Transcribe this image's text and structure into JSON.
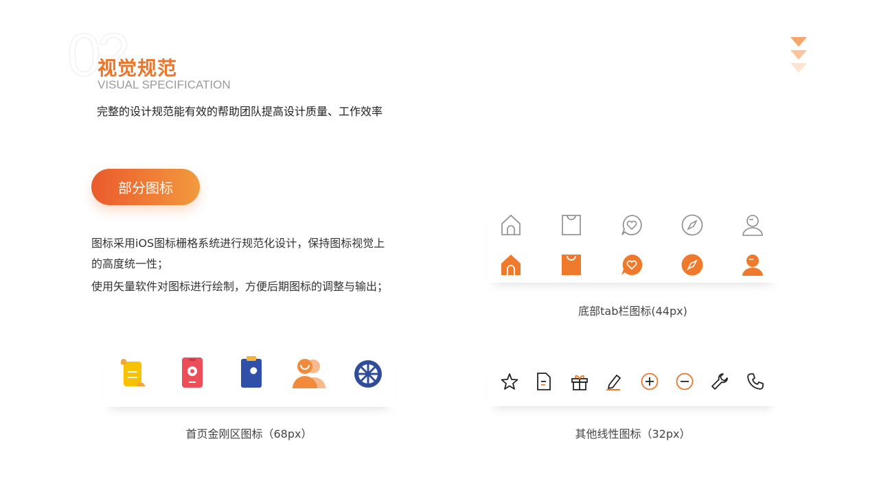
{
  "header": {
    "section_number": "02",
    "title_cn": "视觉规范",
    "title_en": "VISUAL SPECIFICATION",
    "subtitle": "完整的设计规范能有效的帮助团队提高设计质量、工作效率"
  },
  "colors": {
    "accent": "#e8762b",
    "tab_active": "#f07a2c",
    "outline": "#888888",
    "line_icon": "#222222"
  },
  "section_tag": "部分图标",
  "description": {
    "line1": "图标采用iOS图标栅格系统进行规范化设计，保持图标视觉上",
    "line2": "的高度统一性；",
    "line3": "使用矢量软件对图标进行绘制，方便后期图标的调整与输出；"
  },
  "groups": {
    "home_icons": {
      "caption": "首页金刚区图标（68px）",
      "icons": [
        "scroll-document-icon",
        "phone-location-icon",
        "clipboard-wrench-icon",
        "users-icon",
        "wheel-icon"
      ]
    },
    "tab_icons": {
      "caption": "底部tab栏图标(44px)",
      "icons": [
        "home-icon",
        "bag-icon",
        "chat-heart-icon",
        "compass-icon",
        "user-icon"
      ]
    },
    "line_icons": {
      "caption": "其他线性图标（32px）",
      "icons": [
        "star-icon",
        "document-icon",
        "gift-icon",
        "pen-icon",
        "plus-circle-icon",
        "minus-circle-icon",
        "wrench-icon",
        "phone-icon"
      ]
    }
  }
}
